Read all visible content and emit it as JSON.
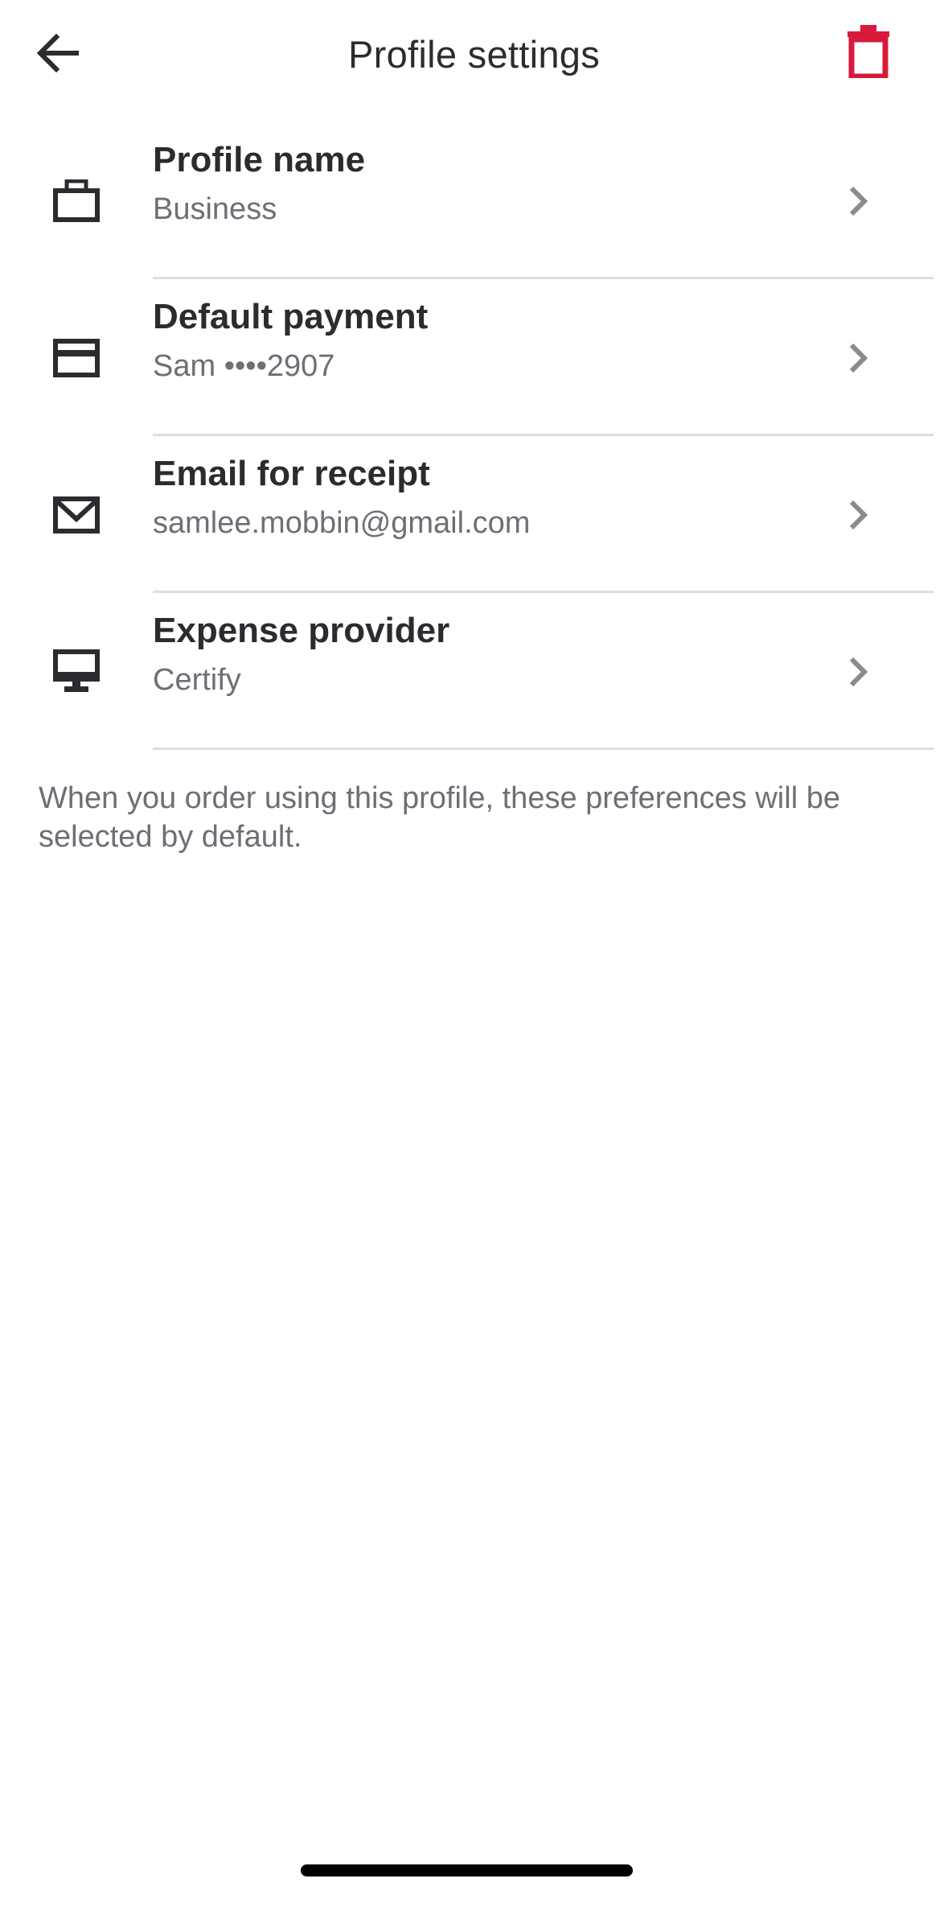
{
  "header": {
    "title": "Profile settings",
    "back_icon": "arrow-left-icon",
    "delete_icon": "trash-icon",
    "delete_color": "#d7193a"
  },
  "settings": [
    {
      "icon": "briefcase-icon",
      "title": "Profile name",
      "value": "Business"
    },
    {
      "icon": "credit-card-icon",
      "title": "Default payment",
      "value": "Sam ••••2907"
    },
    {
      "icon": "envelope-icon",
      "title": "Email for receipt",
      "value": "samlee.mobbin@gmail.com"
    },
    {
      "icon": "monitor-icon",
      "title": "Expense provider",
      "value": "Certify"
    }
  ],
  "footer_note": "When you order using this profile, these preferences will be selected by default.",
  "colors": {
    "text_primary": "#2b2b30",
    "text_secondary": "#6e6e76",
    "chevron": "#8a8a90",
    "divider": "#dedee0",
    "accent_red": "#d7193a"
  }
}
